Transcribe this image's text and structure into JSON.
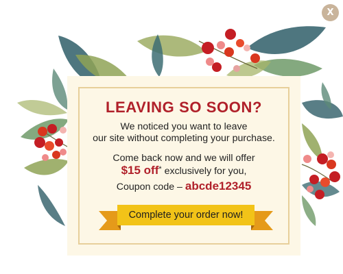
{
  "close_button": {
    "label": "X",
    "icon": "close-icon"
  },
  "popup": {
    "headline": "LEAVING SO SOON?",
    "message_line1": "We noticed you want to leave",
    "message_line2": "our site without completing your purchase.",
    "offer_intro": "Come back now and we will offer",
    "offer_amount": "$15 off",
    "offer_asterisk": "*",
    "offer_suffix": " exclusively for you,",
    "coupon_prefix": "Coupon code – ",
    "coupon_code": "abcde12345",
    "cta_label": "Complete your order now!"
  },
  "colors": {
    "accent_red": "#b0202a",
    "cta_yellow": "#f2c318",
    "ribbon_orange": "#e59a1a",
    "popup_bg": "#fdf7e6",
    "frame_border": "#e7cf9a",
    "close_bg": "#c9b49b"
  }
}
